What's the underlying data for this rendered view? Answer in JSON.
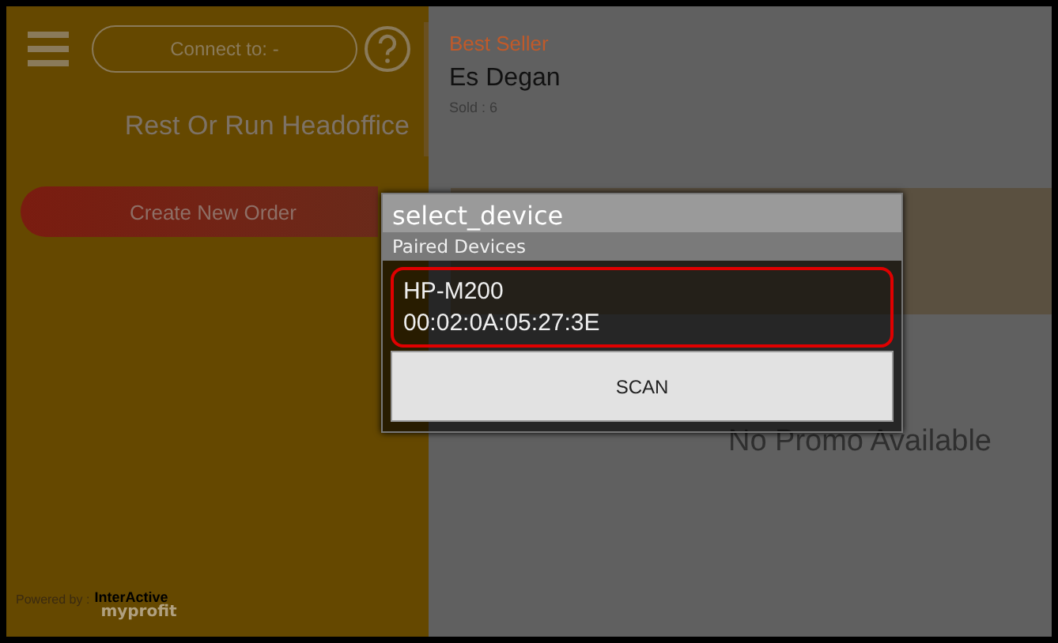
{
  "header": {
    "connect_label": "Connect to: -"
  },
  "store_name": "Rest Or Run Headoffice",
  "create_order_button": "Create New Order",
  "footer": {
    "powered_by": "Powered by :",
    "brand_top": "InterActive",
    "brand_bottom": "myprofit"
  },
  "best_seller": {
    "heading": "Best Seller",
    "items": [
      {
        "name": "Es Degan",
        "sold": "Sold : 6"
      }
    ]
  },
  "promo_message": "No Promo Available",
  "dialog": {
    "title": "select_device",
    "section": "Paired Devices",
    "devices": [
      {
        "name": "HP-M200",
        "address": "00:02:0A:05:27:3E",
        "selected": true
      }
    ],
    "scan_button": "SCAN"
  }
}
